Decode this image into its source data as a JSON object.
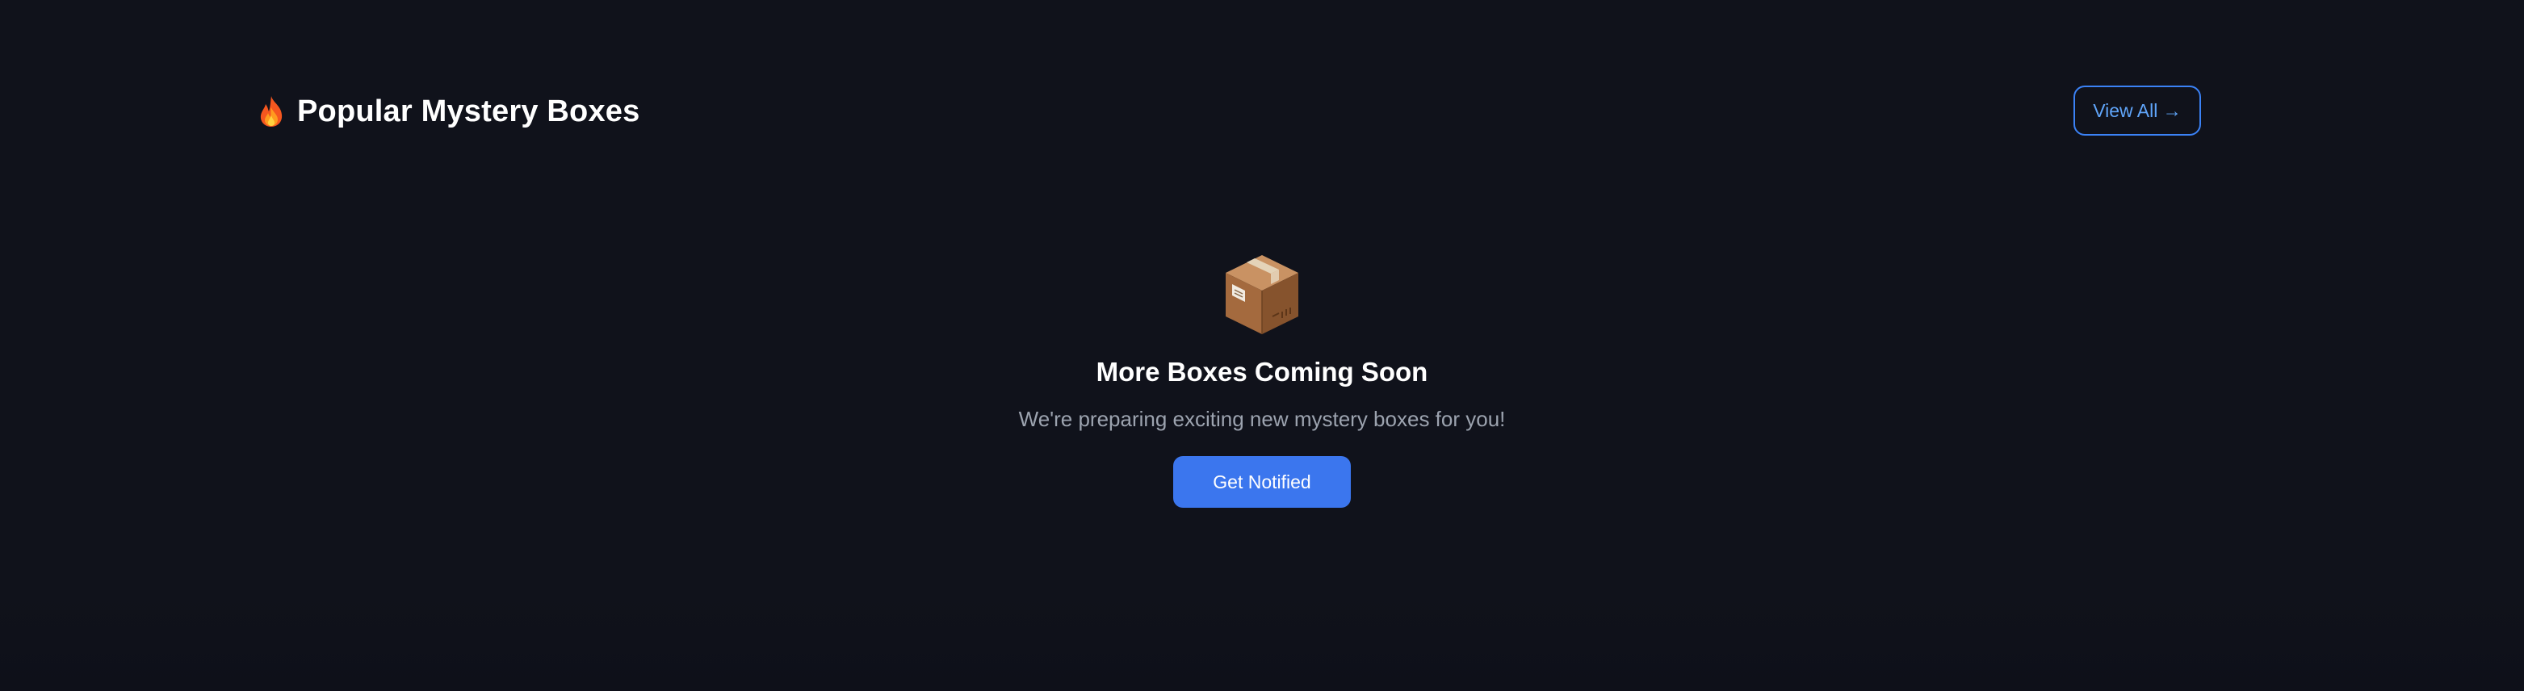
{
  "section": {
    "title_icon": "fire-icon",
    "title": "Popular Mystery Boxes",
    "view_all_label": "View All →"
  },
  "empty_state": {
    "icon": "package-box-icon",
    "title": "More Boxes Coming Soon",
    "subtitle": "We're preparing exciting new mystery boxes for you!",
    "button_label": "Get Notified"
  },
  "colors": {
    "background": "#10121b",
    "accent": "#3b76ee",
    "view_all_border": "#3b82f6",
    "view_all_text": "#60a5fa",
    "subtitle_text": "#9ca3af"
  }
}
